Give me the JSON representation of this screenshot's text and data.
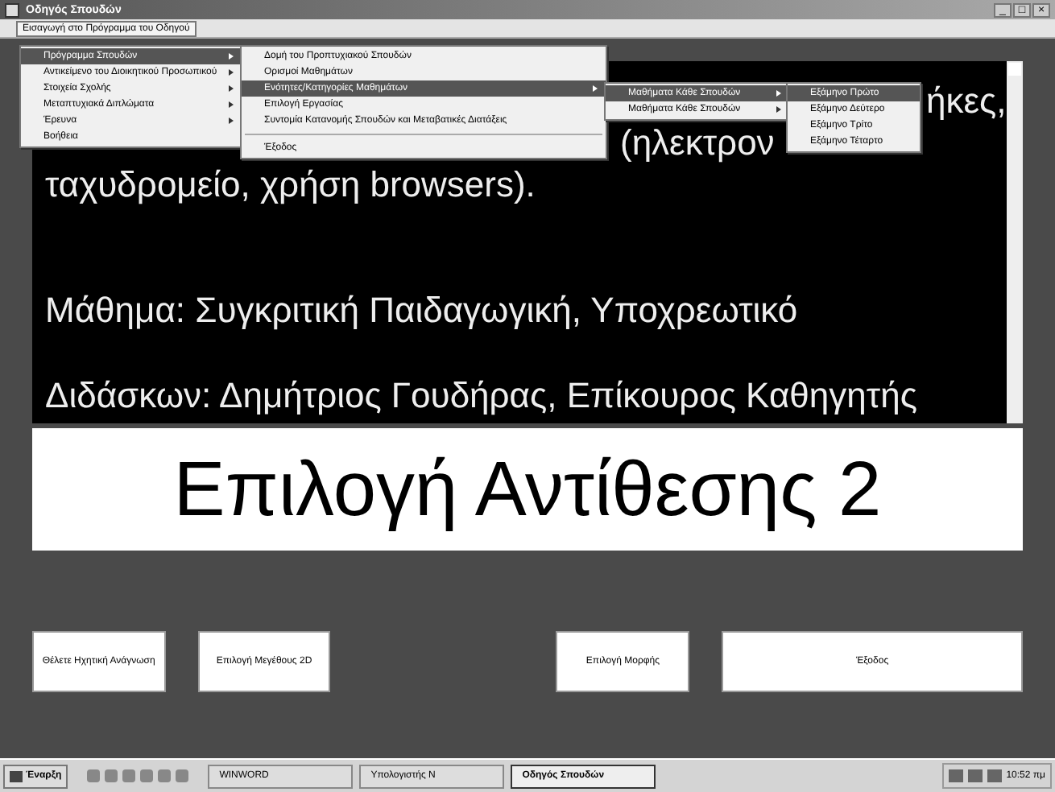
{
  "window": {
    "title": "Οδηγός Σπουδών",
    "controls": [
      "_",
      "□",
      "×"
    ]
  },
  "menu_bar": [
    {
      "label": "Εισαγωγή στο Πρόγραμμα του Οδηγού",
      "selected": true
    }
  ],
  "menus": [
    {
      "items": [
        {
          "kind": "item",
          "label": "Πρόγραμμα Σπουδών",
          "selected": true,
          "submenu": true
        },
        {
          "kind": "item",
          "label": "Αντικείμενο του Διοικητικού Προσωπικού",
          "selected": false,
          "submenu": true
        },
        {
          "kind": "item",
          "label": "Στοιχεία Σχολής",
          "selected": false,
          "submenu": true
        },
        {
          "kind": "item",
          "label": "Μεταπτυχιακά Διπλώματα",
          "selected": false,
          "submenu": true
        },
        {
          "kind": "item",
          "label": "Έρευνα",
          "selected": false,
          "submenu": true
        },
        {
          "kind": "item",
          "label": "Βοήθεια",
          "selected": false,
          "submenu": false
        }
      ]
    },
    {
      "items": [
        {
          "kind": "item",
          "label": "Δομή του Προπτυχιακού Σπουδών",
          "selected": false,
          "submenu": false
        },
        {
          "kind": "item",
          "label": "Ορισμοί Μαθημάτων",
          "selected": false,
          "submenu": false
        },
        {
          "kind": "item",
          "label": "Ενότητες/Κατηγορίες Μαθημάτων",
          "selected": true,
          "submenu": true
        },
        {
          "kind": "item",
          "label": "Επιλογή Εργασίας",
          "selected": false,
          "submenu": false
        },
        {
          "kind": "item",
          "label": "Συντομία Κατανομής Σπουδών και Μεταβατικές Διατάξεις",
          "selected": false,
          "submenu": false
        },
        {
          "kind": "separator"
        },
        {
          "kind": "item",
          "label": "Έξοδος",
          "selected": false,
          "submenu": false
        }
      ]
    },
    {
      "items": [
        {
          "kind": "item",
          "label": "Μαθήματα Κάθε Σπουδών",
          "selected": true,
          "submenu": true
        },
        {
          "kind": "item",
          "label": "Μαθήματα Κάθε Σπουδών",
          "selected": false,
          "submenu": true
        }
      ]
    },
    {
      "items": [
        {
          "kind": "item",
          "label": "Εξάμηνο Πρώτο",
          "selected": true,
          "submenu": false
        },
        {
          "kind": "item",
          "label": "Εξάμηνο Δεύτερο",
          "selected": false,
          "submenu": false
        },
        {
          "kind": "item",
          "label": "Εξάμηνο Τρίτο",
          "selected": false,
          "submenu": false
        },
        {
          "kind": "item",
          "label": "Εξάμηνο Τέταρτο",
          "selected": false,
          "submenu": false
        }
      ]
    }
  ],
  "content": {
    "lines": [
      {
        "kind": "tail",
        "text": "ήκες,"
      },
      {
        "kind": "middle",
        "text": "(ηλεκτρον"
      },
      {
        "kind": "full",
        "text": "ταχυδρομείο, χρήση browsers)."
      },
      {
        "kind": "spaced",
        "text": "Μάθημα:  Συγκριτική Παιδαγωγική, Υποχρεωτικό"
      },
      {
        "kind": "full",
        "text": "Διδάσκων: Δημήτριος Γουδήρας, Επίκουρος Καθηγητής"
      }
    ],
    "banner": "Επιλογή Αντίθεσης 2"
  },
  "buttons": [
    {
      "label": "Θέλετε Ηχητική Ανάγνωση",
      "kind": "small"
    },
    {
      "label": "Επιλογή Μεγέθους 2D",
      "kind": "small"
    },
    {
      "label": "Επιλογή Μορφής",
      "kind": "small"
    },
    {
      "label": "Έξοδος",
      "kind": "wide"
    }
  ],
  "taskbar": {
    "start": "Έναρξη",
    "tasks": [
      {
        "label": "WINWORD",
        "selected": false
      },
      {
        "label": "Υπολογιστής Ν",
        "selected": false
      },
      {
        "label": "Οδηγός Σπουδών",
        "selected": true
      }
    ],
    "clock": "10:52 πμ"
  }
}
